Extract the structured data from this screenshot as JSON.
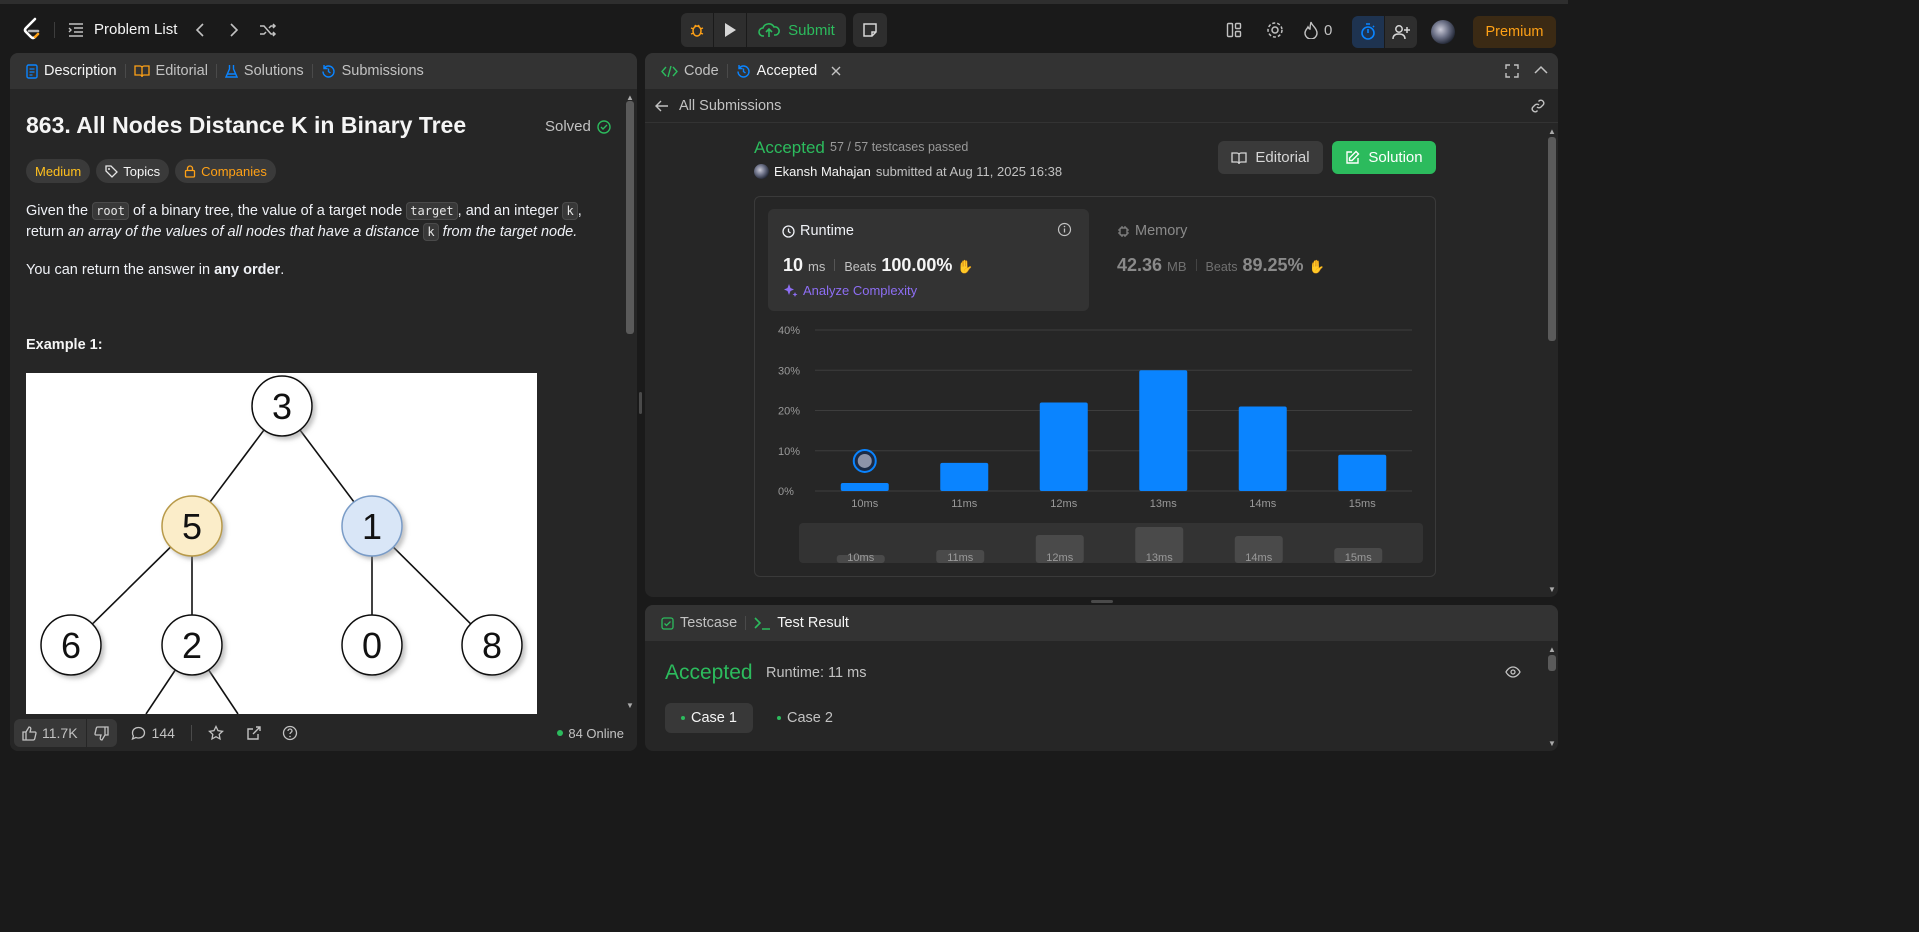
{
  "topbar": {
    "problem_list_label": "Problem List",
    "submit_label": "Submit",
    "streak_count": "0",
    "premium_label": "Premium"
  },
  "left_panel": {
    "tabs": [
      {
        "label": "Description"
      },
      {
        "label": "Editorial"
      },
      {
        "label": "Solutions"
      },
      {
        "label": "Submissions"
      }
    ],
    "problem_title": "863. All Nodes Distance K in Binary Tree",
    "solved_label": "Solved",
    "tags": {
      "difficulty": "Medium",
      "topics": "Topics",
      "companies": "Companies"
    },
    "desc": {
      "p1_a": "Given the ",
      "code_root": "root",
      "p1_b": " of a binary tree, the value of a target node ",
      "code_target": "target",
      "p1_c": ", and an integer ",
      "code_k": "k",
      "p1_d": ", return ",
      "p1_e": "an array of the values of all nodes that have a distance ",
      "code_k2": "k",
      "p1_f": " from the target node",
      "p1_g": ".",
      "p2_a": "You can return the answer in ",
      "p2_b": "any order",
      "p2_c": "."
    },
    "example_label": "Example 1:",
    "tree_nodes": [
      "3",
      "5",
      "1",
      "6",
      "2",
      "0",
      "8"
    ],
    "footer": {
      "likes": "11.7K",
      "comments": "144",
      "online": "84 Online"
    }
  },
  "right_panel": {
    "tabs": [
      {
        "label": "Code"
      },
      {
        "label": "Accepted"
      }
    ],
    "all_submissions_label": "All Submissions",
    "status": "Accepted",
    "testcases": "57 / 57 testcases passed",
    "user": "Ekansh Mahajan",
    "submitted_at": "submitted at Aug 11, 2025 16:38",
    "editorial_btn": "Editorial",
    "solution_btn": "Solution",
    "runtime": {
      "label": "Runtime",
      "value": "10",
      "unit": "ms",
      "beats_label": "Beats",
      "beats": "100.00%",
      "analyze": "Analyze Complexity"
    },
    "memory": {
      "label": "Memory",
      "value": "42.36",
      "unit": "MB",
      "beats_label": "Beats",
      "beats": "89.25%"
    }
  },
  "chart_data": {
    "type": "bar",
    "categories": [
      "10ms",
      "11ms",
      "12ms",
      "13ms",
      "14ms",
      "15ms"
    ],
    "values": [
      2,
      7,
      22,
      30,
      21,
      9
    ],
    "ylim": [
      0,
      40
    ],
    "y_ticks": [
      "0%",
      "10%",
      "20%",
      "30%",
      "40%"
    ],
    "bar_color": "#0a84ff",
    "highlight_category": "10ms"
  },
  "test_panel": {
    "tabs": [
      {
        "label": "Testcase"
      },
      {
        "label": "Test Result"
      }
    ],
    "status": "Accepted",
    "runtime": "Runtime: 11 ms",
    "cases": [
      "Case 1",
      "Case 2"
    ]
  },
  "colors": {
    "accent_green": "#2cbb5d",
    "medium_yellow": "#ffc01e",
    "blue": "#0a84ff",
    "premium": "#ffa116"
  }
}
